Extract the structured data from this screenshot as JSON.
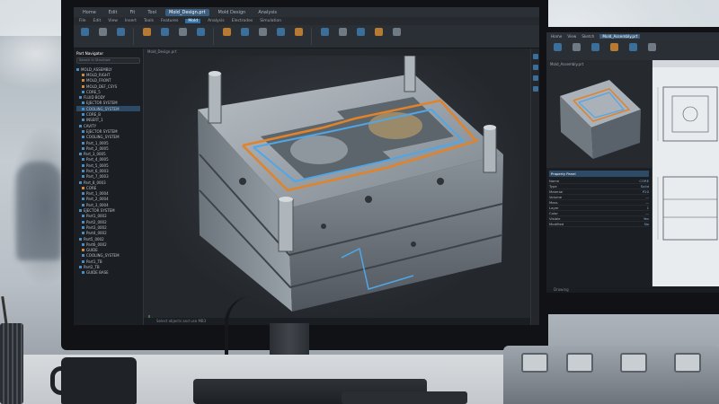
{
  "main_app": {
    "titlebar_tabs": [
      "Home",
      "Edit",
      "Fit",
      "Tool",
      "Mold_Design.prt",
      "Mold Design",
      "Analysis"
    ],
    "active_titlebar_tab": 4,
    "menu_items": [
      "File",
      "Edit",
      "View",
      "Insert",
      "Tools",
      "Features",
      "Mold",
      "Analysis",
      "Electrodes",
      "Simulation"
    ],
    "active_menu_item": 6,
    "tree_header": "Part Navigator",
    "tree_search_placeholder": "Search in Structure",
    "tree_nodes": [
      {
        "label": "MOLD_ASSEMBLY",
        "color": "#4a8cc0"
      },
      {
        "label": "MOLD_RIGHT",
        "color": "#c88b3e"
      },
      {
        "label": "MOLD_FRONT",
        "color": "#c88b3e"
      },
      {
        "label": "MOLD_DEF_CSYS",
        "color": "#c88b3e"
      },
      {
        "label": "CORE_5",
        "color": "#4a8cc0"
      },
      {
        "label": "FLUID BODY",
        "color": "#4a8cc0"
      },
      {
        "label": "EJECTOR SYSTEM",
        "color": "#4a8cc0"
      },
      {
        "label": "COOLING_SYSTEM",
        "color": "#4a8cc0"
      },
      {
        "label": "CORE_B",
        "color": "#4a8cc0"
      },
      {
        "label": "INSERT_1",
        "color": "#4a8cc0"
      },
      {
        "label": "CAVITY",
        "color": "#4a8cc0"
      },
      {
        "label": "EJECTOR SYSTEM",
        "color": "#4a8cc0"
      },
      {
        "label": "COOLING_SYSTEM",
        "color": "#4a8cc0"
      },
      {
        "label": "Part_1_0005",
        "color": "#4a8cc0"
      },
      {
        "label": "Part_2_0005",
        "color": "#4a8cc0"
      },
      {
        "label": "Part_3_0005",
        "color": "#4a8cc0"
      },
      {
        "label": "Part_4_0005",
        "color": "#4a8cc0"
      },
      {
        "label": "Part_5_0005",
        "color": "#4a8cc0"
      },
      {
        "label": "Part_6_0003",
        "color": "#4a8cc0"
      },
      {
        "label": "Part_7_0003",
        "color": "#4a8cc0"
      },
      {
        "label": "Part_8_0003",
        "color": "#4a8cc0"
      },
      {
        "label": "CORE",
        "color": "#c88b3e"
      },
      {
        "label": "Part_1_0004",
        "color": "#4a8cc0"
      },
      {
        "label": "Part_2_0004",
        "color": "#4a8cc0"
      },
      {
        "label": "Part_3_0004",
        "color": "#4a8cc0"
      },
      {
        "label": "EJECTOR SYSTEM",
        "color": "#4a8cc0"
      },
      {
        "label": "Part1_0002",
        "color": "#4a8cc0"
      },
      {
        "label": "Part2_0002",
        "color": "#4a8cc0"
      },
      {
        "label": "Part3_0002",
        "color": "#4a8cc0"
      },
      {
        "label": "Part4_0002",
        "color": "#4a8cc0"
      },
      {
        "label": "Part5_0002",
        "color": "#4a8cc0"
      },
      {
        "label": "Part6_0002",
        "color": "#4a8cc0"
      },
      {
        "label": "GUIDE",
        "color": "#c88b3e"
      },
      {
        "label": "COOLING_SYSTEM",
        "color": "#4a8cc0"
      },
      {
        "label": "Part1_TB",
        "color": "#4a8cc0"
      },
      {
        "label": "Part2_TB",
        "color": "#4a8cc0"
      },
      {
        "label": "GUIDE BASE",
        "color": "#4a8cc0"
      }
    ],
    "selected_node": 7,
    "viewport_tab": "Mold_Design.prt",
    "status_text": "Select objects and use MB3"
  },
  "side_app": {
    "titlebar_tabs": [
      "Home",
      "View",
      "Sketch",
      "Mold_Assembly.prt"
    ],
    "active_titlebar_tab": 3,
    "model_label": "Mold_Assembly.prt",
    "props_header": "Property Panel",
    "props_rows": [
      {
        "k": "Name",
        "v": "CORE"
      },
      {
        "k": "Type",
        "v": "Solid"
      },
      {
        "k": "Material",
        "v": "P20"
      },
      {
        "k": "Volume",
        "v": "—"
      },
      {
        "k": "Mass",
        "v": "—"
      },
      {
        "k": "Layer",
        "v": "1"
      },
      {
        "k": "Color",
        "v": "—"
      },
      {
        "k": "Visible",
        "v": "Yes"
      },
      {
        "k": "Modified",
        "v": "No"
      }
    ],
    "status_text": "Drawing"
  },
  "colors": {
    "accent": "#3a5d7e",
    "cooling_orange": "#e0832a",
    "cooling_blue": "#4fa6e8",
    "steel": "#8b949c"
  }
}
